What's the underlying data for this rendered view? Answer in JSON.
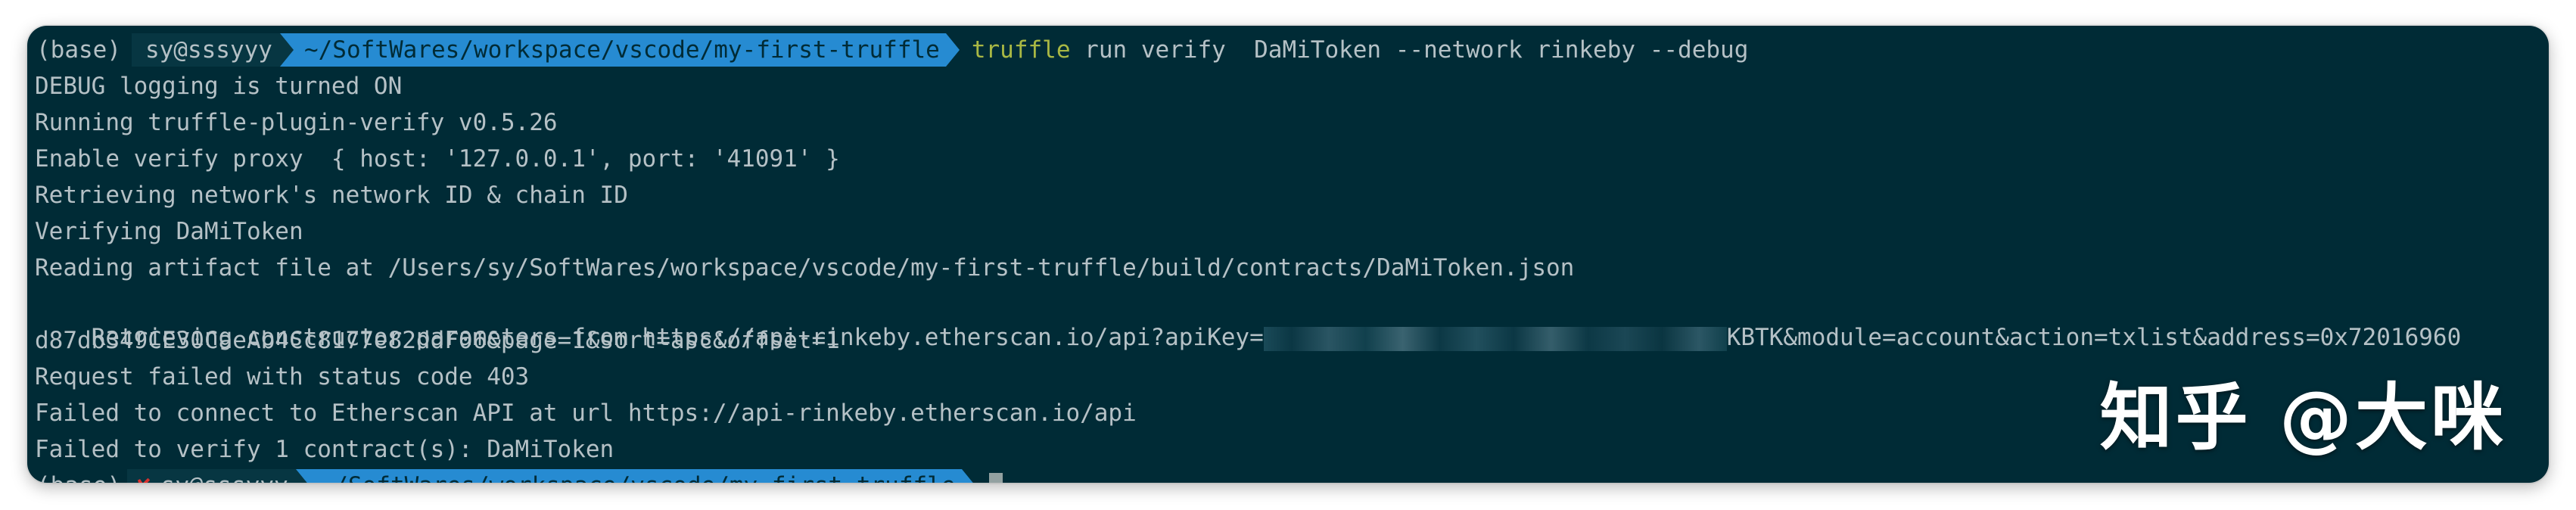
{
  "prompt": {
    "env": "(base)",
    "user": "sy@sssyyy",
    "dir": "~/SoftWares/workspace/vscode/my-first-truffle",
    "error_mark": "✘"
  },
  "command": {
    "name": "truffle",
    "args": " run verify  DaMiToken --network rinkeby --debug"
  },
  "output": [
    "DEBUG logging is turned ON",
    "Running truffle-plugin-verify v0.5.26",
    "Enable verify proxy  { host: '127.0.0.1', port: '41091' }",
    "Retrieving network's network ID & chain ID",
    "Verifying DaMiToken",
    "Reading artifact file at /Users/sy/SoftWares/workspace/vscode/my-first-truffle/build/contracts/DaMiToken.json"
  ],
  "constructor_line": {
    "prefix": "Retrieving constructor parameters from https://api-rinkeby.etherscan.io/api?apiKey=",
    "suffix": "KBTK&module=account&action=txlist&address=0x72016960",
    "continuation": "d87db349CE30CaeAb4Cc8177e82ddF06&page=1&sort=asc&offset=1"
  },
  "output_after": [
    "Request failed with status code 403",
    "Failed to connect to Etherscan API at url https://api-rinkeby.etherscan.io/api",
    "Failed to verify 1 contract(s): DaMiToken"
  ],
  "watermark": "知乎 @大咪",
  "colors": {
    "background": "#002b36",
    "text": "#b5c1c6",
    "command": "#a9b844",
    "path_segment": "#268bd2",
    "user_segment": "#073642",
    "error": "#dc322f"
  }
}
